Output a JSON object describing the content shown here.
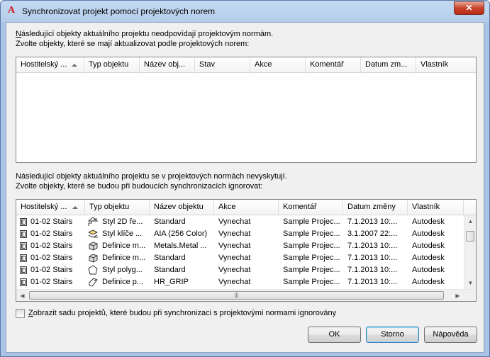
{
  "window": {
    "title": "Synchronizovat projekt pomocí projektových norem",
    "app_icon": "autocad-a-icon",
    "close_label": "✕"
  },
  "top_section": {
    "line1": "Následující objekty aktuálního projektu neodpovídají projektovým normám.",
    "line1_mnemonic": "N",
    "line1_rest": "ásledující objekty aktuálního projektu neodpovídají projektovým normám.",
    "line2": "Zvolte objekty, které se mají aktualizovat podle projektových norem:",
    "columns": [
      "Hostitelský ...",
      "Typ objektu",
      "Název obj...",
      "Stav",
      "Akce",
      "Komentář",
      "Datum zm...",
      "Vlastník"
    ],
    "rows": []
  },
  "bottom_section": {
    "line1": "Následující objekty aktuálního projektu se v projektových normách nevyskytují.",
    "line2": "Zvolte objekty, které se budou při budoucích synchronizacích ignorovat:",
    "columns": [
      "Hostitelský ...",
      "Typ objektu",
      "Název objektu",
      "Akce",
      "Komentář",
      "Datum změny",
      "Vlastník"
    ],
    "rows": [
      {
        "host": "01-02 Stairs",
        "type_icon": "stair-style-icon",
        "type": "Styl 2D ře...",
        "name": "Standard",
        "action": "Vynechat",
        "comment": "Sample Projec...",
        "date": "7.1.2013 10:...",
        "owner": "Autodesk"
      },
      {
        "host": "01-02 Stairs",
        "type_icon": "layer-key-style-icon",
        "type": "Styl klíče ...",
        "name": "AIA (256 Color)",
        "action": "Vynechat",
        "comment": "Sample Projec...",
        "date": "3.1.2007 22:...",
        "owner": "Autodesk"
      },
      {
        "host": "01-02 Stairs",
        "type_icon": "material-definition-icon",
        "type": "Definice m...",
        "name": "Metals.Metal ...",
        "action": "Vynechat",
        "comment": "Sample Projec...",
        "date": "7.1.2013 10:...",
        "owner": "Autodesk"
      },
      {
        "host": "01-02 Stairs",
        "type_icon": "material-definition-icon",
        "type": "Definice m...",
        "name": "Standard",
        "action": "Vynechat",
        "comment": "Sample Projec...",
        "date": "7.1.2013 10:...",
        "owner": "Autodesk"
      },
      {
        "host": "01-02 Stairs",
        "type_icon": "polygon-style-icon",
        "type": "Styl polyg...",
        "name": "Standard",
        "action": "Vynechat",
        "comment": "Sample Projec...",
        "date": "7.1.2013 10:...",
        "owner": "Autodesk"
      },
      {
        "host": "01-02 Stairs",
        "type_icon": "property-set-definition-icon",
        "type": "Definice p...",
        "name": "HR_GRIP",
        "action": "Vynechat",
        "comment": "Sample Projec...",
        "date": "7.1.2013 10:...",
        "owner": "Autodesk"
      }
    ],
    "host_icon": "drawing-file-icon"
  },
  "checkbox": {
    "label": "Zobrazit sadu projektů, které budou při synchronizaci s projektovými normami ignorovány",
    "label_mnemonic": "Z",
    "label_rest": "obrazit sadu projektů, které budou při synchronizaci s projektovými normami ignorovány",
    "checked": false
  },
  "buttons": {
    "ok": "OK",
    "cancel": "Storno",
    "help": "Nápověda"
  }
}
